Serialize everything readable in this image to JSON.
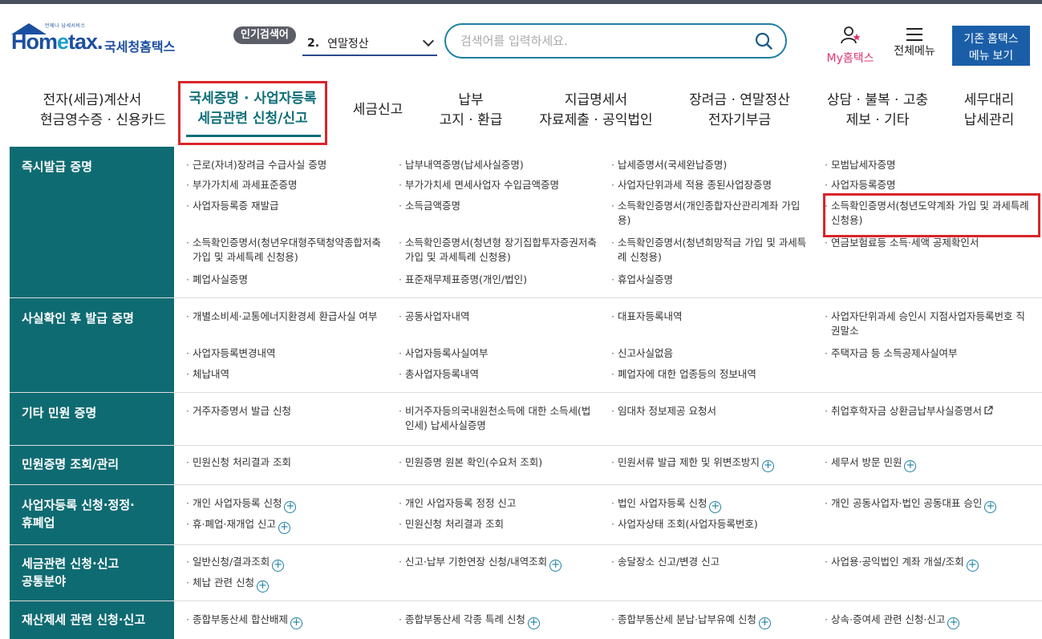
{
  "colors": {
    "brand": "#1d4fa0",
    "teal": "#0f6b72",
    "highlight": "#d9252a",
    "accent_pink": "#e0366d"
  },
  "logo": {
    "sub": "언제나 납세서비스",
    "main_a": "Hom",
    "main_e": "e",
    "main_b": "tax.",
    "kr": "국세청홈택스"
  },
  "header": {
    "popular_badge": "인기검색어",
    "popular_rank": "2.",
    "popular_term": "연말정산",
    "search_placeholder": "검색어를 입력하세요.",
    "my_hometax": "My홈택스",
    "all_menu": "전체메뉴",
    "legacy_line1": "기존 홈택스",
    "legacy_line2": "메뉴 보기"
  },
  "nav": [
    {
      "l1": "전자(세금)계산서",
      "l2": "현금영수증 · 신용카드"
    },
    {
      "l1": "국세증명 · 사업자등록",
      "l2": "세금관련 신청/신고"
    },
    {
      "l1": "세금신고",
      "l2": ""
    },
    {
      "l1": "납부",
      "l2": "고지 · 환급"
    },
    {
      "l1": "지급명세서",
      "l2": "자료제출 · 공익법인"
    },
    {
      "l1": "장려금 · 연말정산",
      "l2": "전자기부금"
    },
    {
      "l1": "상담 · 불복 · 고충",
      "l2": "제보 · 기타"
    },
    {
      "l1": "세무대리",
      "l2": "납세관리"
    }
  ],
  "sections": [
    {
      "title": "즉시발급 증명",
      "items": [
        "근로(자녀)장려금 수급사실 증명",
        "납부내역증명(납세사실증명)",
        "납세증명서(국세완납증명)",
        "모범납세자증명",
        "부가가치세 과세표준증명",
        "부가가치세 면세사업자 수입금액증명",
        "사업자단위과세 적용 종된사업장증명",
        "사업자등록증명",
        "사업자등록증 재발급",
        "소득금액증명",
        "소득확인증명서(개인종합자산관리계좌 가입용)",
        "소득확인증명서(청년도약계좌 가입 및 과세특례 신청용)",
        "소득확인증명서(청년우대형주택청약종합저축 가입 및 과세특례 신청용)",
        "소득확인증명서(청년형 장기집합투자증권저축 가입 및 과세특례 신청용)",
        "소득확인증명서(청년희망적금 가입 및 과세특례 신청용)",
        "연금보험료등 소득·세액 공제확인서",
        "폐업사실증명",
        "표준재무제표증명(개인/법인)",
        "휴업사실증명"
      ]
    },
    {
      "title": "사실확인 후 발급 증명",
      "items": [
        "개별소비세·교통에너지환경세 환급사실 여부",
        "공동사업자내역",
        "대표자등록내역",
        "사업자단위과세 승인시 지점사업자등록번호 직권말소",
        "사업자등록변경내역",
        "사업자등록사실여부",
        "신고사실없음",
        "주택자금 등 소득공제사실여부",
        "체납내역",
        "총사업자등록내역",
        "폐업자에 대한 업종등의 정보내역"
      ]
    },
    {
      "title": "기타 민원 증명",
      "items": [
        "거주자증명서 발급 신청",
        "비거주자등의국내원천소득에 대한 소득세(법인세) 납세사실증명",
        "임대차 정보제공 요청서",
        "취업후학자금 상환금납부사실증명서"
      ]
    },
    {
      "title": "민원증명 조회/관리",
      "items": [
        "민원신청 처리결과 조회",
        "민원증명 원본 확인(수요처 조회)",
        "민원서류 발급 제한 및 위변조방지",
        "세무서 방문 민원"
      ]
    },
    {
      "title1": "사업자등록 신청·정정·",
      "title2": "휴폐업",
      "items": [
        "개인 사업자등록 신청",
        "개인 사업자등록 정정 신고",
        "법인 사업자등록 신청",
        "개인 공동사업자·법인 공동대표 승인",
        "휴·폐업·재개업 신고",
        "민원신청 처리결과 조회",
        "사업자상태 조회(사업자등록번호)"
      ]
    },
    {
      "title1": "세금관련 신청·신고",
      "title2": "공통분야",
      "items": [
        "일반신청/결과조회",
        "신고·납부 기한연장 신청/내역조회",
        "송달장소 신고/변경 신고",
        "사업용·공익법인 계좌 개설/조회",
        "체납 관련 신청"
      ]
    },
    {
      "title": "재산제세 관련 신청·신고",
      "items": [
        "종합부동산세 합산배제",
        "종합부동산세 각종 특례 신청",
        "종합부동산세 분납·납부유예 신청",
        "상속·증여세 관련 신청·신고"
      ]
    }
  ]
}
